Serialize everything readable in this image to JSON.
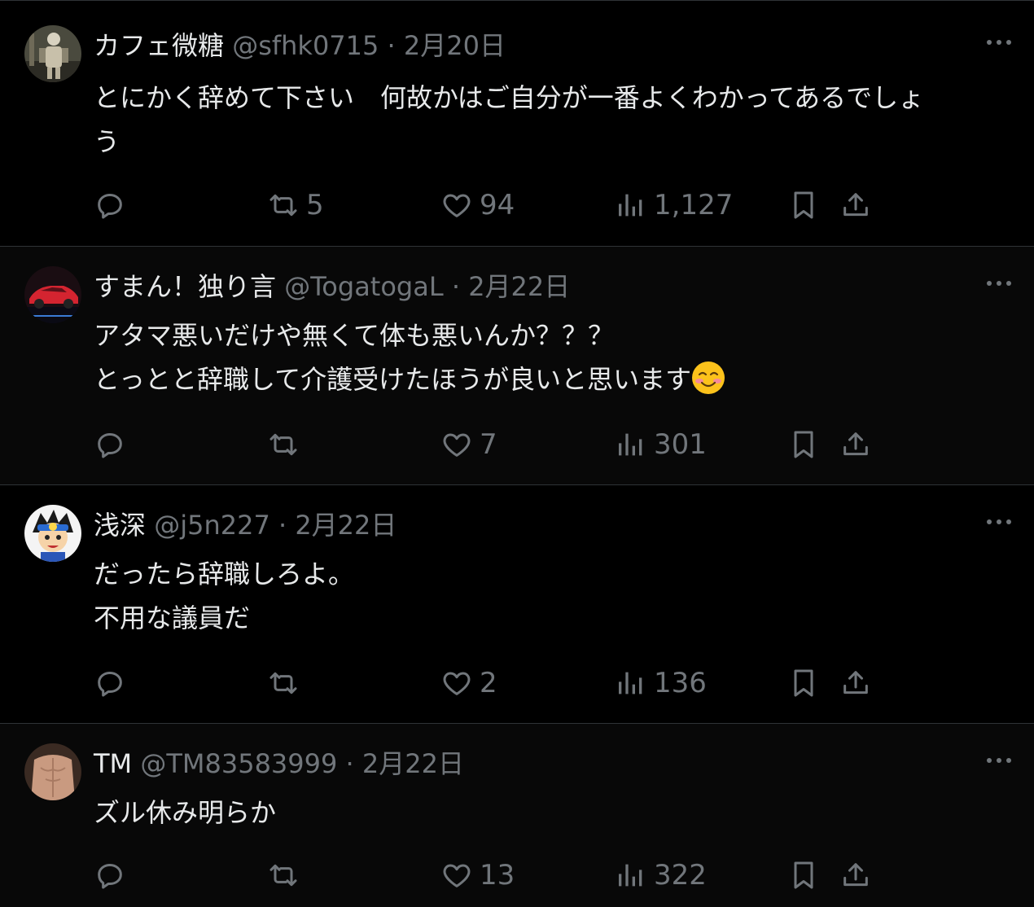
{
  "theme": {
    "background": "#000000",
    "text": "#e7e9ea",
    "muted": "#71767b",
    "border": "#2f3336"
  },
  "tweets": [
    {
      "name": "カフェ微糖",
      "handle": "@sfhk0715",
      "separator": "·",
      "date": "2月20日",
      "text": "とにかく辞めて下さい　何故かはご自分が一番よくわかってあるでしょ\nう",
      "reply_count": "",
      "retweet_count": "5",
      "like_count": "94",
      "view_count": "1,127"
    },
    {
      "name": "すまん！独り言",
      "handle": "@TogatogaL",
      "separator": "·",
      "date": "2月22日",
      "text": "アタマ悪いだけや無くて体も悪いんか？？？\nとっとと辞職して介護受けたほうが良いと思います",
      "text_emoji": "smiling-face-with-blushing-cheeks",
      "reply_count": "",
      "retweet_count": "",
      "like_count": "7",
      "view_count": "301"
    },
    {
      "name": "浅深",
      "handle": "@j5n227",
      "separator": "·",
      "date": "2月22日",
      "text": "だったら辞職しろよ。\n不用な議員だ",
      "reply_count": "",
      "retweet_count": "",
      "like_count": "2",
      "view_count": "136"
    },
    {
      "name": "TM",
      "handle": "@TM83583999",
      "separator": "·",
      "date": "2月22日",
      "text": "ズル休み明らか",
      "reply_count": "",
      "retweet_count": "",
      "like_count": "13",
      "view_count": "322"
    }
  ]
}
